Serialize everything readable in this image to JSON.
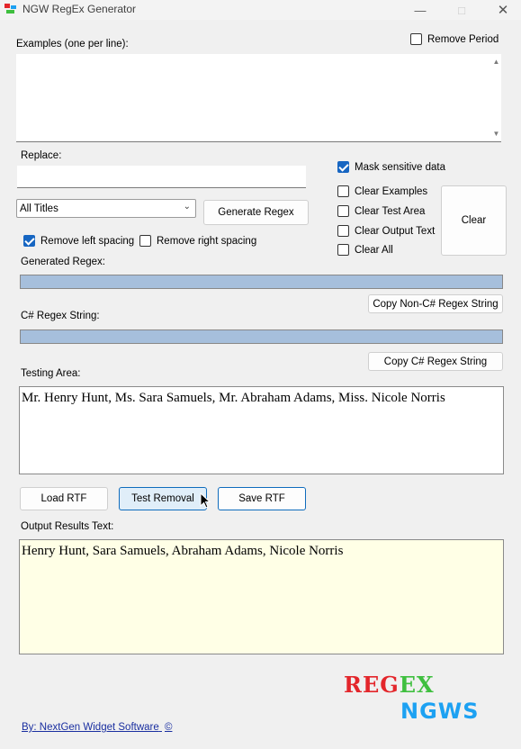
{
  "window": {
    "title": "NGW RegEx Generator",
    "minimize_icon": "minimize-icon",
    "maximize_icon": "maximize-icon",
    "close_icon": "close-icon"
  },
  "examples": {
    "label": "Examples (one per line):",
    "value": ""
  },
  "remove_period": {
    "label": "Remove Period",
    "checked": false
  },
  "replace": {
    "label": "Replace:",
    "value": ""
  },
  "mask_sensitive": {
    "label": "Mask sensitive data",
    "checked": true
  },
  "clear_options": {
    "examples": {
      "label": "Clear Examples",
      "checked": false
    },
    "test_area": {
      "label": "Clear Test Area",
      "checked": false
    },
    "output_text": {
      "label": "Clear Output Text",
      "checked": false
    },
    "all": {
      "label": "Clear All",
      "checked": false
    }
  },
  "clear_button": "Clear",
  "titles_dropdown": {
    "selected": "All Titles"
  },
  "generate_button": "Generate Regex",
  "remove_left": {
    "label": "Remove left spacing",
    "checked": true
  },
  "remove_right": {
    "label": "Remove right spacing",
    "checked": false
  },
  "generated_regex": {
    "label": "Generated Regex:",
    "value": ""
  },
  "copy_non_csharp_button": "Copy Non-C# Regex String",
  "csharp_regex": {
    "label": "C# Regex String:",
    "value": ""
  },
  "copy_csharp_button": "Copy C# Regex String",
  "testing_area": {
    "label": "Testing Area:",
    "value": "Mr. Henry Hunt, Ms. Sara Samuels, Mr. Abraham Adams, Miss. Nicole Norris"
  },
  "buttons": {
    "load_rtf": "Load RTF",
    "test_removal": "Test Removal",
    "save_rtf": "Save RTF"
  },
  "output": {
    "label": "Output Results Text:",
    "value": "Henry Hunt, Sara Samuels, Abraham Adams, Nicole Norris"
  },
  "footer_link": "By: NextGen Widget Software",
  "logo": {
    "line1_part1": "REG",
    "line1_part2": "EX",
    "line2": "NGWS",
    "colors": {
      "red": "#e3262b",
      "green": "#3fbf3f",
      "blue": "#1da1f2"
    }
  },
  "colors": {
    "accent": "#1766c2",
    "button_border_blue": "#0f6cbd",
    "regex_bar": "#a6bfdc",
    "output_bg": "#ffffe6"
  }
}
